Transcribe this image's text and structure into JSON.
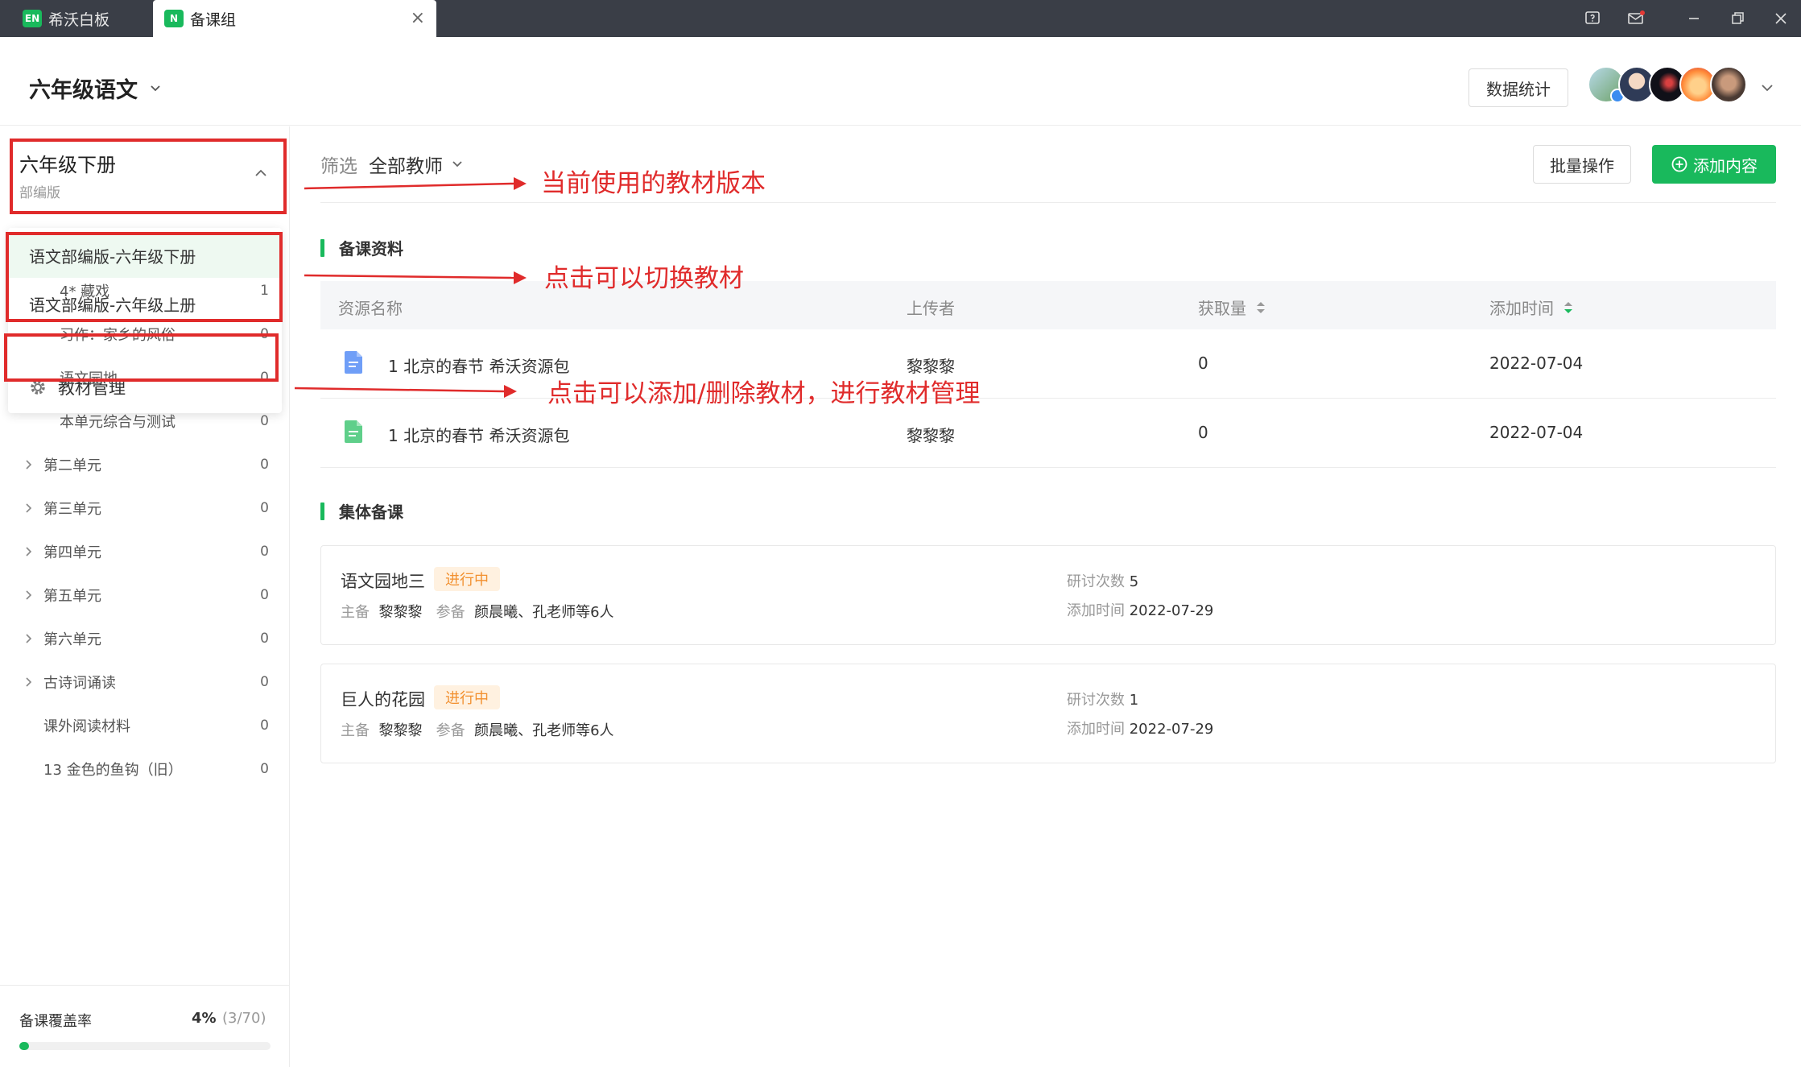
{
  "tabs": [
    {
      "logo": "EN",
      "label": "希沃白板"
    },
    {
      "logo": "N",
      "label": "备课组",
      "close": "×"
    }
  ],
  "window_controls": [
    "help-icon",
    "mail-icon",
    "minimize-icon",
    "restore-icon",
    "close-icon"
  ],
  "header": {
    "course": "六年级语文",
    "stats_button": "数据统计"
  },
  "sidebar": {
    "book_title": "六年级下册",
    "book_edition": "部编版",
    "book_options": [
      "语文部编版-六年级下册",
      "语文部编版-六年级上册"
    ],
    "manage_label": "教材管理",
    "tree": [
      {
        "label": "4* 藏戏",
        "count": "1"
      },
      {
        "label": "习作：家乡的风俗",
        "count": "0"
      },
      {
        "label": "语文园地",
        "count": "0"
      },
      {
        "label": "本单元综合与测试",
        "count": "0"
      },
      {
        "label": "第二单元",
        "count": "0"
      },
      {
        "label": "第三单元",
        "count": "0"
      },
      {
        "label": "第四单元",
        "count": "0"
      },
      {
        "label": "第五单元",
        "count": "0"
      },
      {
        "label": "第六单元",
        "count": "0"
      },
      {
        "label": "古诗词诵读",
        "count": "0"
      },
      {
        "label": "课外阅读材料",
        "count": "0"
      },
      {
        "label": "13 金色的鱼钩（旧）",
        "count": "0"
      }
    ],
    "coverage": {
      "label": "备课覆盖率",
      "percent": "4%",
      "fraction": "(3/70)",
      "progress": 0.04
    }
  },
  "main": {
    "filter_label": "筛选",
    "filter_value": "全部教师",
    "batch_button": "批量操作",
    "add_button": "添加内容",
    "resources": {
      "title": "备课资料",
      "columns": [
        "资源名称",
        "上传者",
        "获取量",
        "添加时间"
      ],
      "rows": [
        {
          "name": "1 北京的春节 希沃资源包",
          "uploader": "黎黎黎",
          "downloads": "0",
          "date": "2022-07-04",
          "icon": "doc-blue-icon"
        },
        {
          "name": "1 北京的春节 希沃资源包",
          "uploader": "黎黎黎",
          "downloads": "0",
          "date": "2022-07-04",
          "icon": "doc-green-icon"
        }
      ]
    },
    "collective": {
      "title": "集体备课",
      "cards": [
        {
          "title": "语文园地三",
          "status": "进行中",
          "lead_label": "主备",
          "lead": "黎黎黎",
          "part_label": "参备",
          "participants": "颜晨曦、孔老师等6人",
          "count_label": "研讨次数",
          "count": "5",
          "date_label": "添加时间",
          "date": "2022-07-29"
        },
        {
          "title": "巨人的花园",
          "status": "进行中",
          "lead_label": "主备",
          "lead": "黎黎黎",
          "part_label": "参备",
          "participants": "颜晨曦、孔老师等6人",
          "count_label": "研讨次数",
          "count": "1",
          "date_label": "添加时间",
          "date": "2022-07-29"
        }
      ]
    }
  },
  "annotations": [
    "当前使用的教材版本",
    "点击可以切换教材",
    "点击可以添加/删除教材，进行教材管理"
  ],
  "colors": {
    "accent": "#19b95c",
    "annotation": "#e02b2b",
    "badge_bg": "#fff1e0",
    "badge_text": "#f2902f",
    "titlebar": "#3a3e47"
  }
}
